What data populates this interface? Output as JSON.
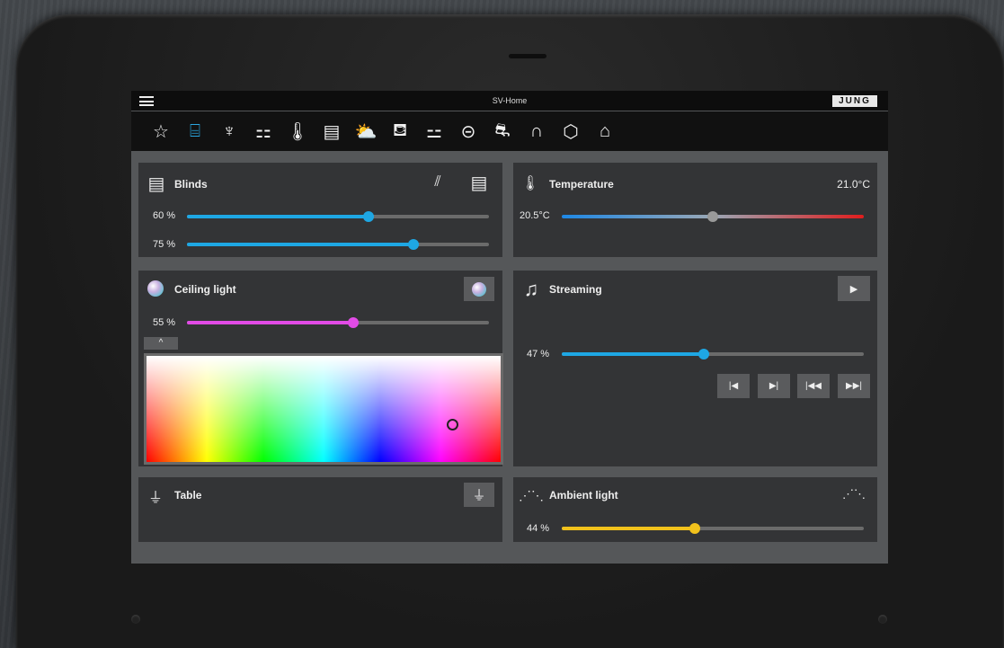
{
  "app": {
    "title": "SV-Home",
    "brand": "JUNG"
  },
  "nav_icons": [
    {
      "name": "favorites-star-icon",
      "glyph": "☆"
    },
    {
      "name": "room-office-icon",
      "glyph": "⌸"
    },
    {
      "name": "room-dining-icon",
      "glyph": "♆"
    },
    {
      "name": "room-living-icon",
      "glyph": "⚏"
    },
    {
      "name": "thermometer-icon",
      "glyph": "🌡"
    },
    {
      "name": "blinds-icon",
      "glyph": "▤"
    },
    {
      "name": "weather-icon",
      "glyph": "⛅"
    },
    {
      "name": "room-bath-icon",
      "glyph": "⛾"
    },
    {
      "name": "room-bedroom-icon",
      "glyph": "⚍"
    },
    {
      "name": "room-kitchen-icon",
      "glyph": "⊝"
    },
    {
      "name": "car-garage-icon",
      "glyph": "⛐"
    },
    {
      "name": "outdoor-icon",
      "glyph": "∩"
    },
    {
      "name": "cube-icon",
      "glyph": "⬡"
    },
    {
      "name": "home-icon",
      "glyph": "⌂"
    }
  ],
  "blinds": {
    "title": "Blinds",
    "sliders": [
      {
        "label": "60 %",
        "value": 0.6
      },
      {
        "label": "75 %",
        "value": 0.75
      }
    ]
  },
  "temperature": {
    "title": "Temperature",
    "setpoint": "21.0°C",
    "current": "20.5°C",
    "value": 0.5
  },
  "ceiling_light": {
    "title": "Ceiling light",
    "label": "55 %",
    "value": 0.55,
    "collapse_glyph": "^"
  },
  "streaming": {
    "title": "Streaming",
    "play_glyph": "▶",
    "volume_label": "47 %",
    "volume": 0.47,
    "controls": [
      "|◀",
      "▶|",
      "|◀◀",
      "▶▶|"
    ]
  },
  "table": {
    "title": "Table"
  },
  "ambient_light": {
    "title": "Ambient light",
    "label": "44 %",
    "value": 0.44
  },
  "colors": {
    "blue": "#1ea7e4",
    "magenta": "#e24be6",
    "yellow": "#f2c21c",
    "red": "#e11d1d"
  }
}
